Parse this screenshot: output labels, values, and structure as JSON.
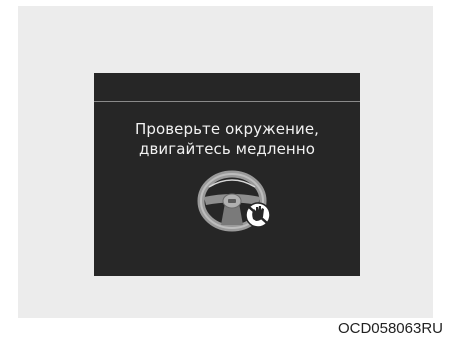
{
  "warning": {
    "line1": "Проверьте окружение,",
    "line2": "двигайтесь медленно",
    "icon": "steering-wheel-hands-off-icon"
  },
  "figure": {
    "code": "OCD058063RU"
  },
  "colors": {
    "screen_bg": "#262626",
    "panel_bg": "#ececec",
    "text": "#f2f2f2"
  }
}
